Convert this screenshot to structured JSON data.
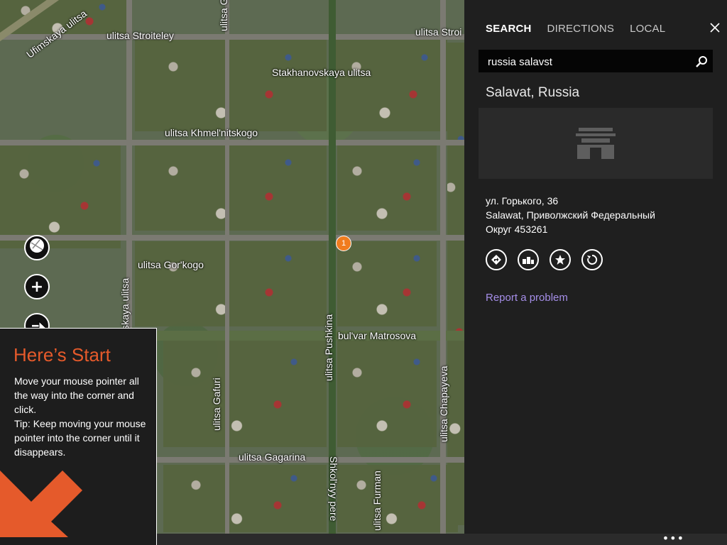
{
  "map": {
    "labels": {
      "ufimskaya": "Ufimskaya ulitsa",
      "stroiteley_left": "ulitsa Stroiteley",
      "stroiteley_right": "ulitsa Stroi",
      "stakhanovskaya": "Stakhanovskaya ulitsa",
      "gafuri_top": "ulitsa Gafuri",
      "khmelnitskogo": "ulitsa Khmel'nitskogo",
      "gorkogo": "ulitsa Gor'kogo",
      "kaya_ulitsa": "skaya ulitsa",
      "pushkina": "ulitsa Pushkina",
      "matrosova": "bul'var Matrosova",
      "gafuri_bottom": "ulitsa Gafuri",
      "chapayeva": "ulitsa Chapayeva",
      "gagarina": "ulitsa Gagarina",
      "shkolnyy": "Shkol'nyy pere",
      "furmanova": "ulitsa Furman"
    },
    "marker_number": "1",
    "controls": {
      "plus": "+",
      "minus": "−"
    }
  },
  "tip": {
    "title": "Here’s Start",
    "body": "Move your mouse pointer all the way into the corner and click.\nTip: Keep moving your mouse pointer into the corner until it disappears.",
    "accent": "#e55a2b"
  },
  "panel": {
    "tabs": [
      "SEARCH",
      "DIRECTIONS",
      "LOCAL"
    ],
    "active_tab": "SEARCH",
    "search_value": "russia salavst",
    "result_title": "Salavat, Russia",
    "address_lines": [
      "ул. Горького, 36",
      "Salawat, Приволжский Федеральный",
      "Округ 453261"
    ],
    "report_link": "Report a problem",
    "link_color": "#a58ee8"
  },
  "bottombar": {
    "more": "•••"
  },
  "icons": {
    "close": "close-icon",
    "search": "search-icon",
    "directions": "directions-icon",
    "nearby": "nearby-icon",
    "favorite": "add-favorite-icon",
    "share": "share-icon",
    "map_style": "map-style-icon"
  }
}
